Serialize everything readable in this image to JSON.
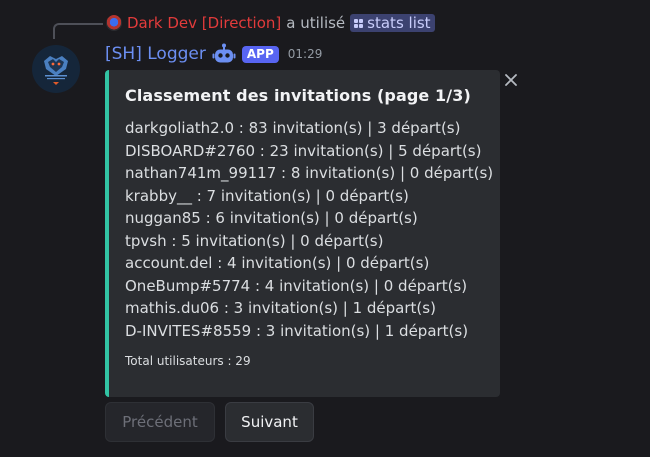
{
  "command_reply": {
    "user": "Dark Dev [Direction]",
    "action_text": "a utilisé",
    "command": "stats list"
  },
  "message": {
    "author": "[SH] Logger",
    "badge": "APP",
    "timestamp": "01:29",
    "author_color": "#6c8ff2"
  },
  "embed": {
    "accent_color": "#32c4a4",
    "title": "Classement des invitations (page 1/3)",
    "lines": [
      "darkgoliath2.0 : 83 invitation(s) | 3 départ(s)",
      "DISBOARD#2760 : 23 invitation(s) | 5 départ(s)",
      "nathan741m_99117 : 8 invitation(s) | 0 départ(s)",
      "krabby__ : 7 invitation(s) | 0 départ(s)",
      "nuggan85 : 6 invitation(s) | 0 départ(s)",
      "tpvsh : 5 invitation(s) | 0 départ(s)",
      "account.del : 4 invitation(s) | 0 départ(s)",
      "OneBump#5774 : 4 invitation(s) | 0 départ(s)",
      "mathis.du06 : 3 invitation(s) | 1 départ(s)",
      "D-INVITES#8559 : 3 invitation(s) | 1 départ(s)"
    ],
    "footer": "Total utilisateurs : 29"
  },
  "buttons": {
    "previous": "Précédent",
    "next": "Suivant"
  },
  "icons": {
    "close": "close-icon",
    "bot": "robot-icon",
    "command": "command-icon"
  }
}
